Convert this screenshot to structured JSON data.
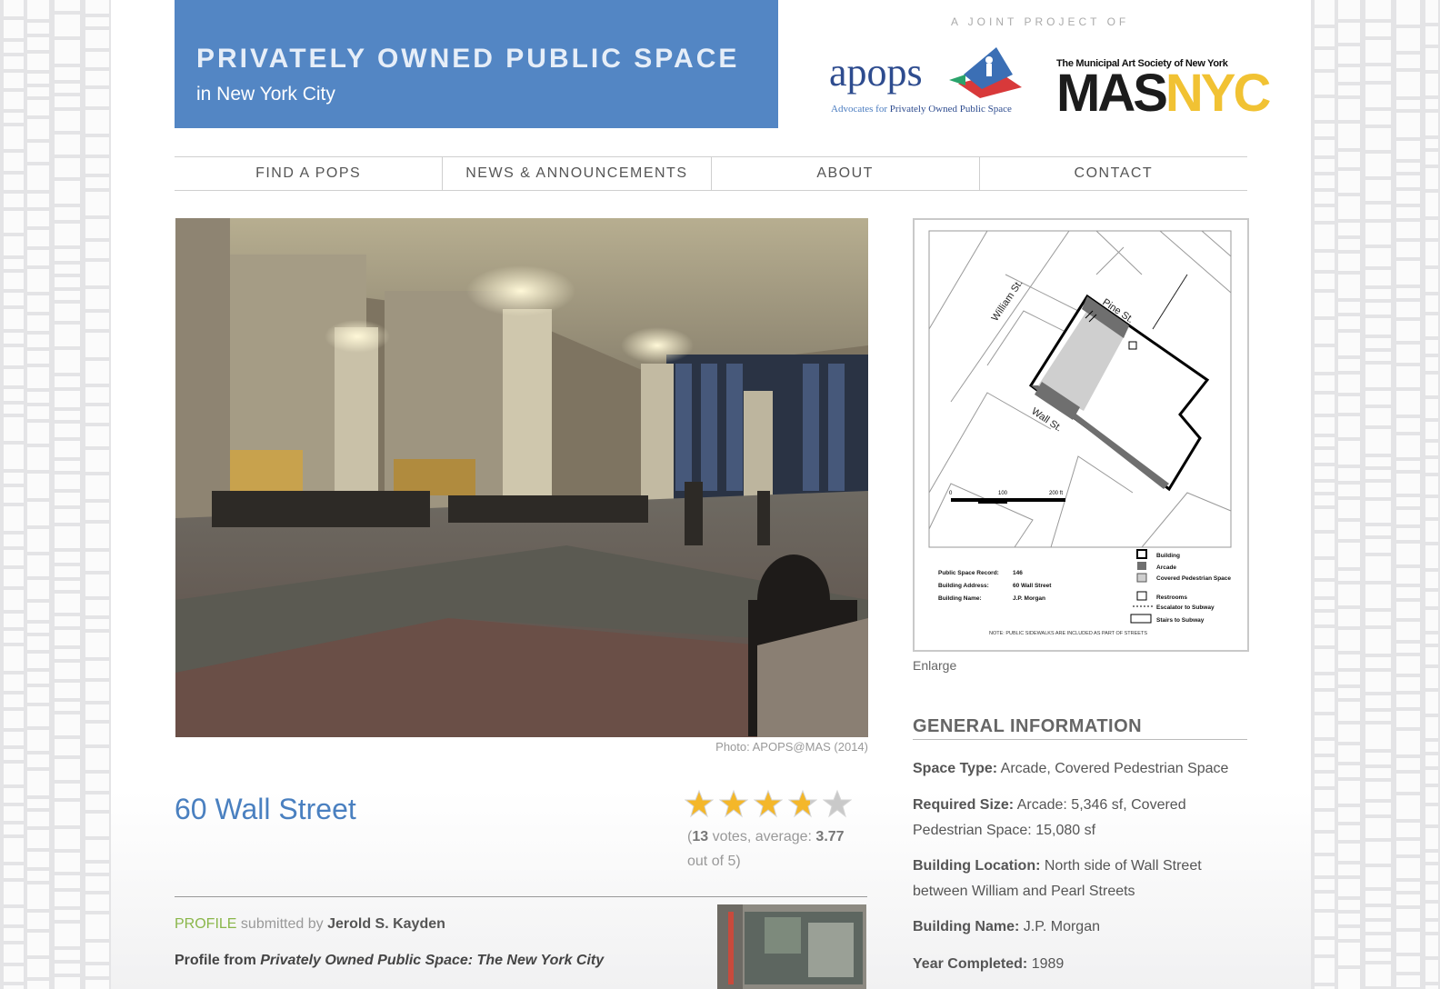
{
  "header": {
    "title": "PRIVATELY OWNED PUBLIC SPACE",
    "subtitle": "in New York City",
    "joint_label": "A JOINT PROJECT OF",
    "apops": {
      "wordmark": "apops",
      "tagline_a": "Advocates for ",
      "tagline_b": "Privately Owned Public Space"
    },
    "mas": {
      "top": "The Municipal Art Society of New York",
      "mas": "MAS",
      "nyc": "NYC"
    },
    "brand_color": "#5386c4"
  },
  "nav": [
    "FIND A POPS",
    "NEWS & ANNOUNCEMENTS",
    "ABOUT",
    "CONTACT"
  ],
  "photo": {
    "credit": "Photo: APOPS@MAS (2014)"
  },
  "map": {
    "streets": {
      "william": "William St.",
      "pine": "Pine St.",
      "wall": "Wall St."
    },
    "scale": {
      "s0": "0",
      "s100": "100",
      "s200": "200 ft"
    },
    "record_rows": [
      {
        "label": "Public Space Record:",
        "value": "146"
      },
      {
        "label": "Building Address:",
        "value": "60 Wall Street"
      },
      {
        "label": "Building Name:",
        "value": "J.P. Morgan"
      }
    ],
    "legend": [
      "Building",
      "Arcade",
      "Covered Pedestrian Space",
      "Restrooms",
      "Escalator to Subway",
      "Stairs to Subway"
    ],
    "note": "NOTE: PUBLIC SIDEWALKS ARE INCLUDED AS PART OF STREETS",
    "enlarge": "Enlarge"
  },
  "place": {
    "name": "60 Wall Street",
    "rating": {
      "value": 3.77,
      "max": 5,
      "votes": "13",
      "votes_word": " votes, average: ",
      "average": "3.77",
      "out_of": "out of 5)",
      "open": "("
    }
  },
  "profile": {
    "tag": "PROFILE",
    "submitted_by": " submitted by ",
    "author": "Jerold S. Kayden",
    "source_prefix": "Profile from ",
    "source_title": "Privately Owned Public Space: The New York City"
  },
  "general_info": {
    "heading": "GENERAL INFORMATION",
    "fields": [
      {
        "label": "Space Type:",
        "value": " Arcade, Covered Pedestrian Space"
      },
      {
        "label": "Required Size:",
        "value": " Arcade: 5,346 sf, Covered Pedestrian Space: 15,080 sf"
      },
      {
        "label": "Building Location:",
        "value": " North side of Wall Street between William and Pearl Streets"
      },
      {
        "label": "Building Name:",
        "value": " J.P. Morgan"
      },
      {
        "label": "Year Completed:",
        "value": " 1989"
      }
    ]
  }
}
